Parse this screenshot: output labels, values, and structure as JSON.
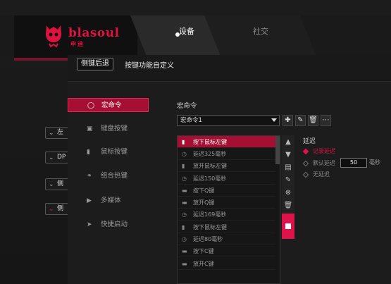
{
  "app": {
    "logo_text": "blasoul",
    "logo_sub": "申迪",
    "nav_tabs": [
      {
        "label": "设备"
      },
      {
        "label": "社交"
      }
    ]
  },
  "background_selects": [
    {
      "label": "左"
    },
    {
      "label": "DP"
    },
    {
      "label": "侧"
    },
    {
      "label": "侧"
    }
  ],
  "dialog": {
    "back_label": "侧键后退",
    "title": "按键功能自定义",
    "menu": [
      {
        "label": "宏命令",
        "icon": "tag-icon",
        "active": true
      },
      {
        "label": "键盘按键",
        "icon": "keyboard-icon",
        "active": false
      },
      {
        "label": "鼠标按键",
        "icon": "mouse-icon",
        "active": false
      },
      {
        "label": "组合热键",
        "icon": "link-icon",
        "active": false
      },
      {
        "label": "多媒体",
        "icon": "play-icon",
        "active": false
      },
      {
        "label": "快捷启动",
        "icon": "send-icon",
        "active": false
      }
    ],
    "macro": {
      "section_title": "宏命令",
      "selected": "宏命令1",
      "events": [
        {
          "label": "按下鼠标左键",
          "icon": "mouse-icon",
          "selected": true
        },
        {
          "label": "延迟325毫秒",
          "icon": "clock-icon"
        },
        {
          "label": "放开鼠标左键",
          "icon": "mouse-icon"
        },
        {
          "label": "延迟150毫秒",
          "icon": "clock-icon"
        },
        {
          "label": "按下Q键",
          "icon": "key-icon"
        },
        {
          "label": "放开Q键",
          "icon": "key-icon"
        },
        {
          "label": "延迟169毫秒",
          "icon": "clock-icon"
        },
        {
          "label": "按下鼠标左键",
          "icon": "mouse-icon"
        },
        {
          "label": "延迟80毫秒",
          "icon": "clock-icon"
        },
        {
          "label": "按下C键",
          "icon": "key-icon"
        },
        {
          "label": "放开C键",
          "icon": "key-icon"
        }
      ]
    },
    "delay": {
      "title": "延迟",
      "options": [
        {
          "label": "记录延迟",
          "checked": true
        },
        {
          "label": "默认延迟",
          "checked": false
        },
        {
          "label": "无延迟",
          "checked": false
        }
      ],
      "default_value": "50",
      "unit": "毫秒"
    }
  },
  "colors": {
    "accent": "#a50f33",
    "record": "#e0124a"
  }
}
